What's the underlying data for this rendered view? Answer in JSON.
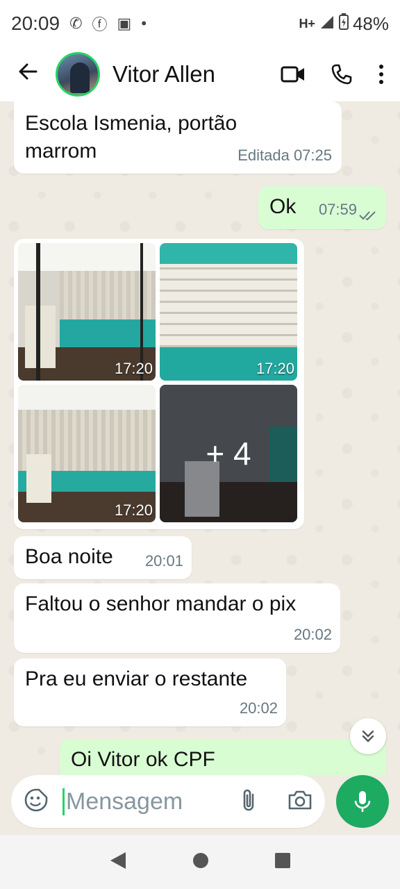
{
  "status_bar": {
    "time": "20:09",
    "network": "H+",
    "battery": "48%"
  },
  "header": {
    "contact_name": "Vitor Allen"
  },
  "messages": [
    {
      "text": "Escola Ismenia, portão marrom",
      "meta": "Editada 07:25"
    },
    {
      "text": "Ok",
      "time": "07:59"
    },
    {
      "text": "Boa noite",
      "time": "20:01"
    },
    {
      "text": "Faltou o senhor mandar o pix",
      "time": "20:02"
    },
    {
      "text": "Pra eu enviar o restante",
      "time": "20:02"
    },
    {
      "text": "Oi Vitor ok CPF"
    }
  ],
  "media": {
    "times": [
      "17:20",
      "17:20",
      "17:20"
    ],
    "more_count": "+ 4"
  },
  "composer": {
    "placeholder": "Mensagem"
  },
  "colors": {
    "accent": "#25d366",
    "mic": "#1daa61",
    "outgoing": "#d9fdd3",
    "incoming": "#ffffff",
    "chat_bg": "#efeae2"
  },
  "icons": [
    "back-arrow-icon",
    "video-call-icon",
    "phone-icon",
    "more-vert-icon",
    "double-check-icon",
    "emoji-icon",
    "attach-icon",
    "camera-icon",
    "mic-icon",
    "scroll-down-icon",
    "nav-back-icon",
    "nav-home-icon",
    "nav-recents-icon"
  ]
}
